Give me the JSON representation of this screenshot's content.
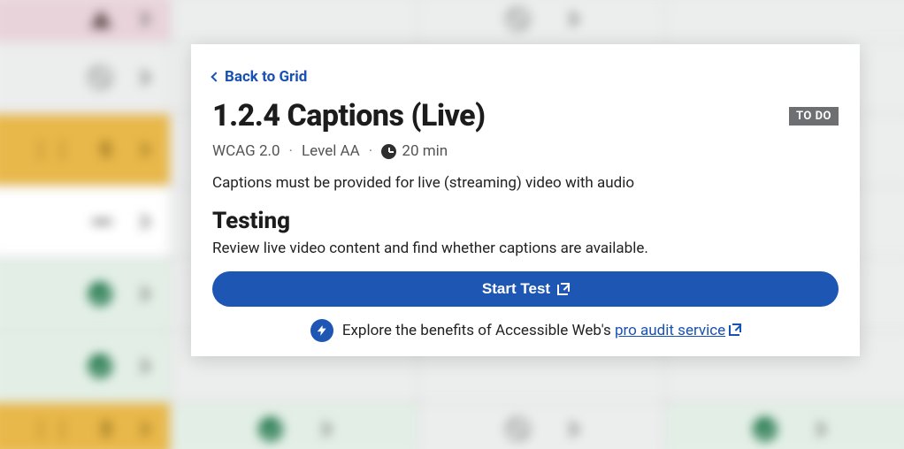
{
  "backLink": {
    "label": "Back to Grid"
  },
  "title": "1.2.4 Captions (Live)",
  "status": "TO DO",
  "meta": {
    "wcag": "WCAG 2.0",
    "level": "Level AA",
    "time": "20 min"
  },
  "description": "Captions must be provided for live (streaming) video with audio",
  "testing": {
    "heading": "Testing",
    "text": "Review live video content and find whether captions are available."
  },
  "startTest": {
    "label": "Start Test"
  },
  "promo": {
    "prefix": "Explore the benefits of Accessible Web's ",
    "linkText": "pro audit service"
  },
  "bgAmberTop": "5",
  "bgAmberBottom": "3"
}
